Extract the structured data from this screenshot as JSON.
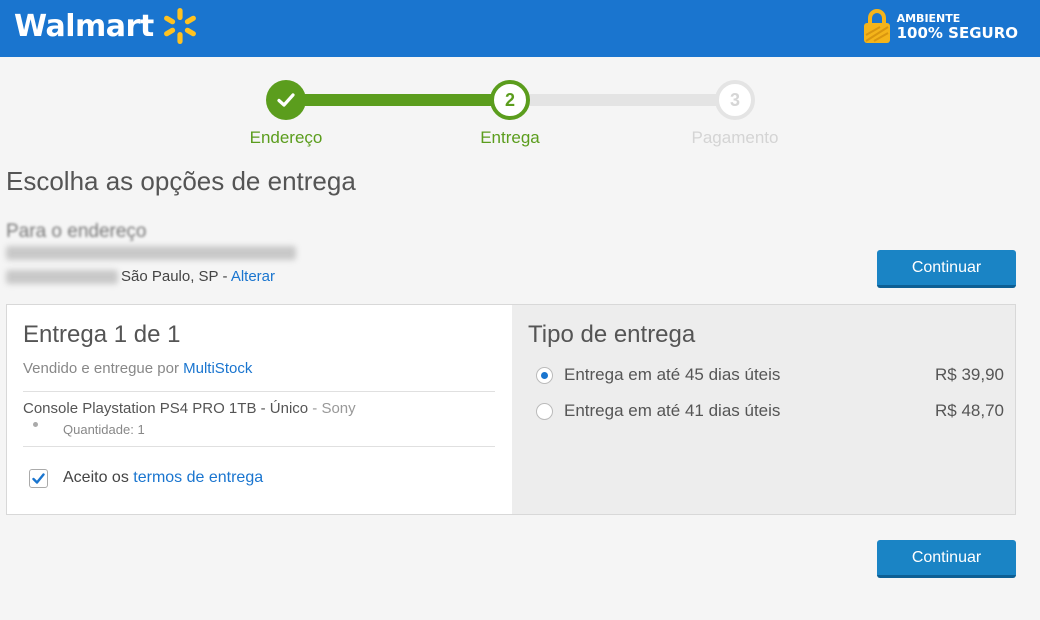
{
  "header": {
    "brand": "Walmart",
    "secure_line1": "AMBIENTE",
    "secure_line2": "100% SEGURO",
    "colors": {
      "bar": "#1a75cf",
      "spark": "#ffc220"
    }
  },
  "steps": [
    {
      "num": "",
      "label": "Endereço",
      "state": "done"
    },
    {
      "num": "2",
      "label": "Entrega",
      "state": "current"
    },
    {
      "num": "3",
      "label": "Pagamento",
      "state": "pending"
    }
  ],
  "page": {
    "title": "Escolha as opções de entrega"
  },
  "address": {
    "heading": "Para o endereço",
    "city": "São Paulo, SP - ",
    "change_link": "Alterar"
  },
  "buttons": {
    "continue_top": "Continuar",
    "continue_bottom": "Continuar"
  },
  "delivery": {
    "title": "Entrega 1 de 1",
    "seller_prefix": "Vendido e entregue por ",
    "seller_name": "MultiStock",
    "product_name": "Console Playstation PS4 PRO 1TB - Único",
    "product_brand": " - Sony",
    "quantity": "Quantidade: 1",
    "terms_prefix": "Aceito os ",
    "terms_link": "termos de entrega",
    "terms_checked": true
  },
  "shipping": {
    "title": "Tipo de entrega",
    "options": [
      {
        "label": "Entrega em até 45 dias úteis",
        "price": "R$ 39,90",
        "selected": true
      },
      {
        "label": "Entrega em até 41 dias úteis",
        "price": "R$ 48,70",
        "selected": false
      }
    ]
  }
}
